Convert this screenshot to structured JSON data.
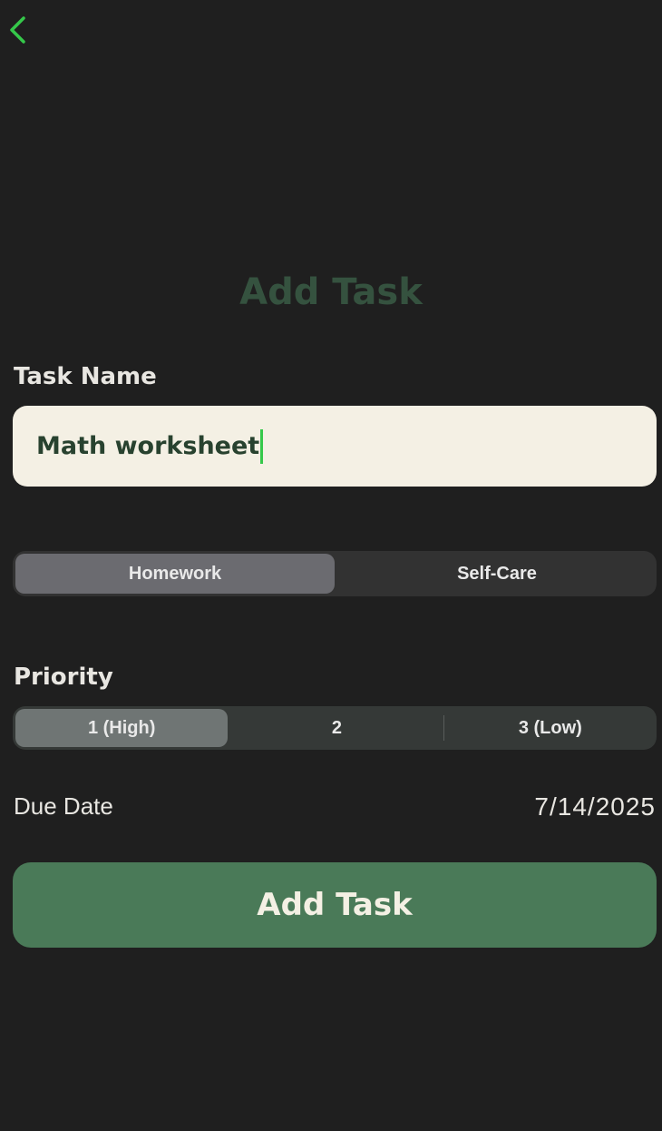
{
  "nav": {
    "back_icon": "chevron-left-icon",
    "accent_color": "#35c84a"
  },
  "header": {
    "title": "Add Task"
  },
  "task_name": {
    "label": "Task Name",
    "value": "Math worksheet"
  },
  "category": {
    "options": [
      "Homework",
      "Self-Care"
    ],
    "selected": "Homework"
  },
  "priority": {
    "label": "Priority",
    "options": [
      "1 (High)",
      "2",
      "3 (Low)"
    ],
    "selected": "1 (High)"
  },
  "due_date": {
    "label": "Due Date",
    "value": "7/14/2025"
  },
  "submit": {
    "label": "Add Task",
    "color": "#4a7a58"
  }
}
